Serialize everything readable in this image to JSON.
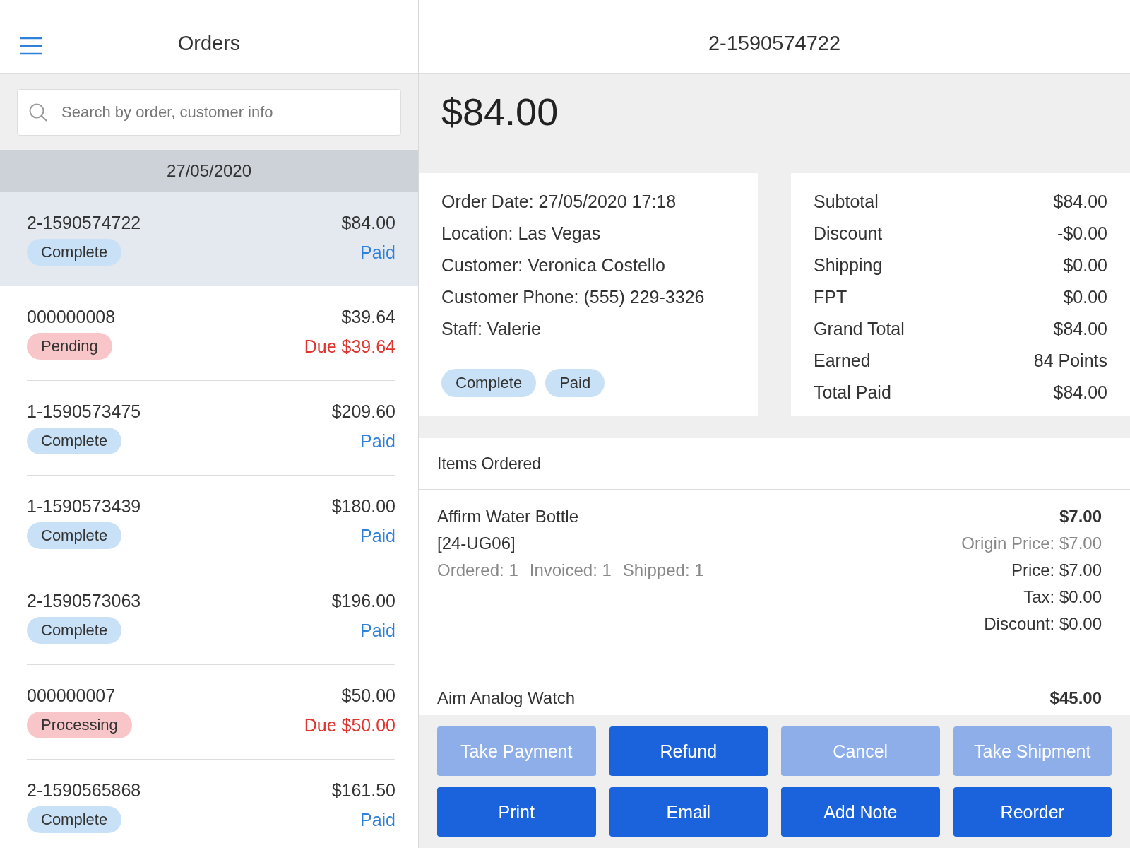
{
  "sidebar": {
    "title": "Orders",
    "search": {
      "placeholder": "Search by order, customer info"
    },
    "date": "27/05/2020",
    "orders": [
      {
        "number": "2-1590574722",
        "total": "$84.00",
        "status": {
          "label": "Complete",
          "color": "#c9e1f6"
        },
        "payment": {
          "text": "Paid",
          "color": "#2f80d9"
        },
        "selected": true
      },
      {
        "number": "000000008",
        "total": "$39.64",
        "status": {
          "label": "Pending",
          "color": "#f8c6c8"
        },
        "payment": {
          "text": "Due $39.64",
          "color": "#e0342f"
        },
        "selected": false
      },
      {
        "number": "1-1590573475",
        "total": "$209.60",
        "status": {
          "label": "Complete",
          "color": "#c9e1f6"
        },
        "payment": {
          "text": "Paid",
          "color": "#2f80d9"
        },
        "selected": false
      },
      {
        "number": "1-1590573439",
        "total": "$180.00",
        "status": {
          "label": "Complete",
          "color": "#c9e1f6"
        },
        "payment": {
          "text": "Paid",
          "color": "#2f80d9"
        },
        "selected": false
      },
      {
        "number": "2-1590573063",
        "total": "$196.00",
        "status": {
          "label": "Complete",
          "color": "#c9e1f6"
        },
        "payment": {
          "text": "Paid",
          "color": "#2f80d9"
        },
        "selected": false
      },
      {
        "number": "000000007",
        "total": "$50.00",
        "status": {
          "label": "Processing",
          "color": "#f8c6c8"
        },
        "payment": {
          "text": "Due $50.00",
          "color": "#e0342f"
        },
        "selected": false
      },
      {
        "number": "2-1590565868",
        "total": "$161.50",
        "status": {
          "label": "Complete",
          "color": "#c9e1f6"
        },
        "payment": {
          "text": "Paid",
          "color": "#2f80d9"
        },
        "selected": false
      }
    ]
  },
  "detail": {
    "title": "2-1590574722",
    "amount": "$84.00",
    "info": [
      "Order Date: 27/05/2020 17:18",
      "Location: Las Vegas",
      "Customer: Veronica Costello",
      "Customer Phone: (555) 229-3326",
      "Staff: Valerie"
    ],
    "tags": [
      "Complete",
      "Paid"
    ],
    "totals": [
      {
        "label": "Subtotal",
        "value": "$84.00"
      },
      {
        "label": "Discount",
        "value": "-$0.00"
      },
      {
        "label": "Shipping",
        "value": "$0.00"
      },
      {
        "label": "FPT",
        "value": "$0.00"
      },
      {
        "label": "Grand Total",
        "value": "$84.00"
      },
      {
        "label": "Earned",
        "value": "84 Points"
      },
      {
        "label": "Total Paid",
        "value": "$84.00"
      }
    ],
    "items_heading": "Items Ordered",
    "items": [
      {
        "name": "Affirm Water Bottle",
        "sku": "[24-UG06]",
        "quantities": [
          "Ordered: 1",
          "Invoiced: 1",
          "Shipped: 1"
        ],
        "price": "$7.00",
        "details": [
          "Origin Price: $7.00",
          "Price: $7.00",
          "Tax: $0.00",
          "Discount: $0.00"
        ]
      },
      {
        "name": "Aim Analog Watch",
        "price": "$45.00"
      }
    ],
    "buttons": [
      {
        "label": "Take Payment",
        "disabled": true
      },
      {
        "label": "Refund",
        "disabled": false
      },
      {
        "label": "Cancel",
        "disabled": true
      },
      {
        "label": "Take Shipment",
        "disabled": true
      },
      {
        "label": "Print",
        "disabled": false
      },
      {
        "label": "Email",
        "disabled": false
      },
      {
        "label": "Add Note",
        "disabled": false
      },
      {
        "label": "Reorder",
        "disabled": false
      }
    ]
  }
}
